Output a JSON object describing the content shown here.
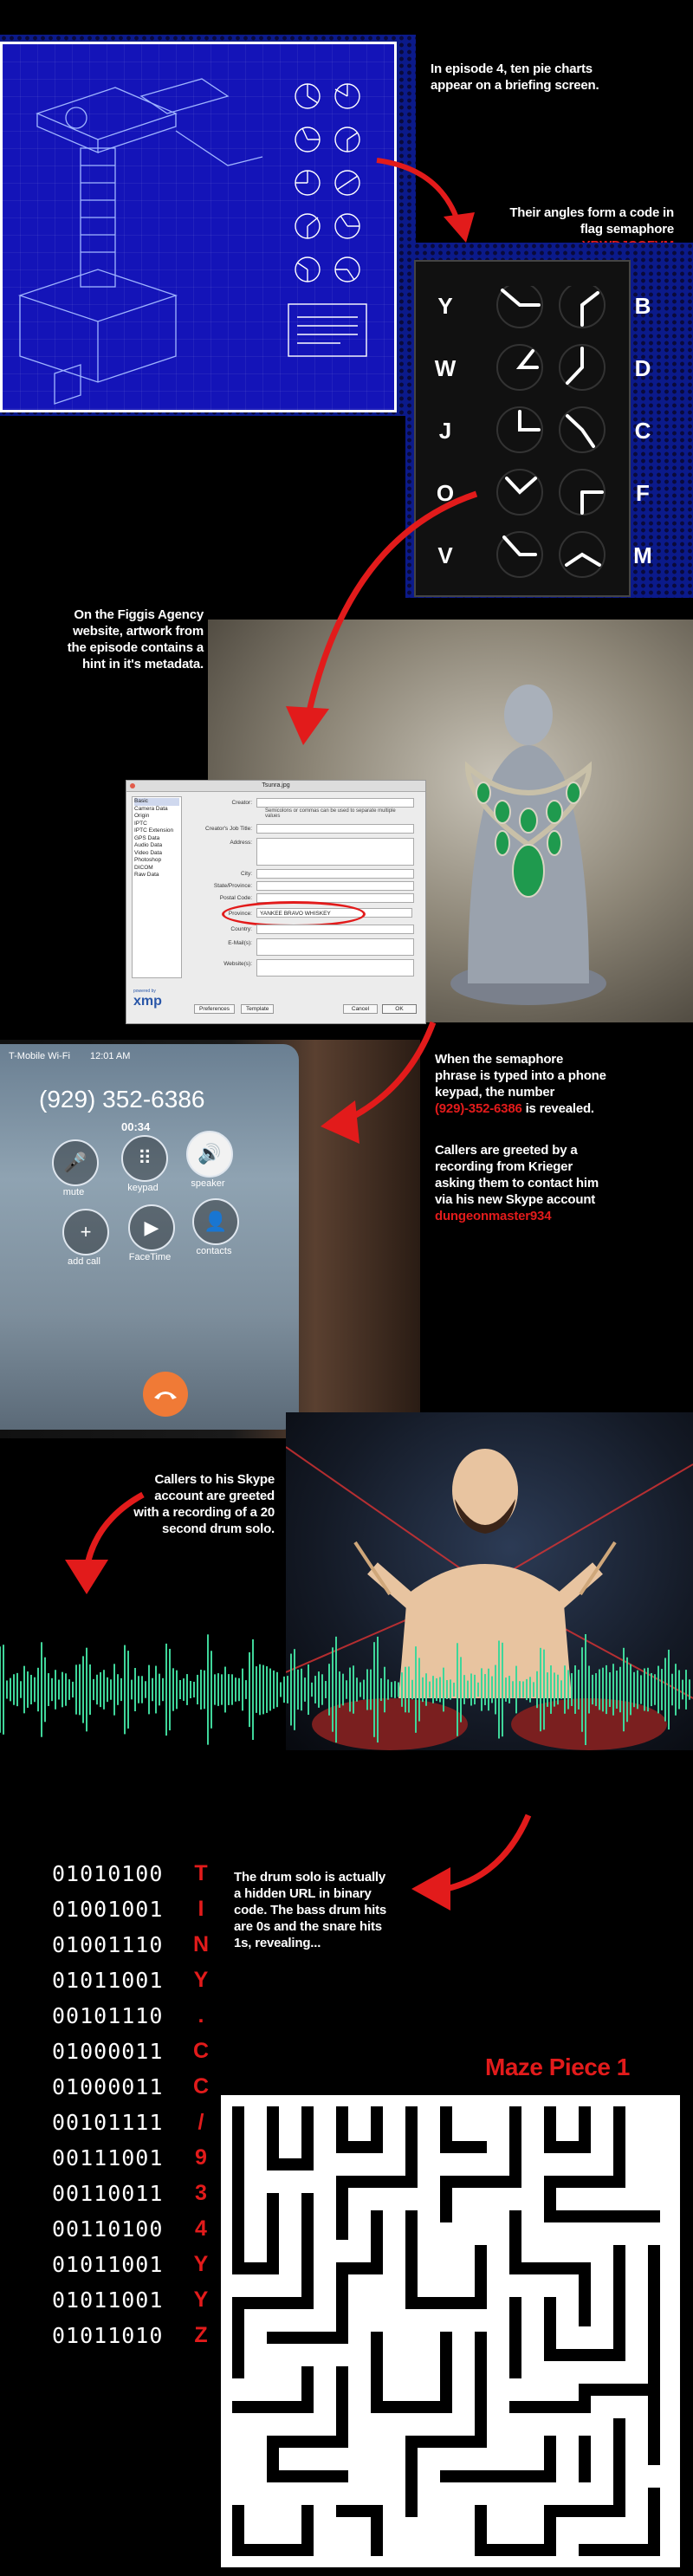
{
  "colors": {
    "accent_red": "#e21b1b",
    "blueprint_blue": "#1414b8",
    "waveform_green": "#3fd69a"
  },
  "captions": {
    "episode": "In episode 4, ten pie charts appear on a briefing screen.",
    "semaphore_prefix": "Their angles form a code in flag semaphore",
    "semaphore_code": "YBWDJCOFVM",
    "figgis": "On the Figgis Agency website, artwork from the episode contains a hint in it's metadata.",
    "phone_prefix": "When the semaphore phrase is typed into a phone keypad, the number",
    "phone_number_red": "(929)-352-6386",
    "phone_suffix": "is revealed.",
    "krieger": "Callers are greeted by a recording from Krieger asking them to contact him via his new Skype account",
    "skype_account": "dungeonmaster934",
    "skype": "Callers to his Skype account are greeted with a recording of a 20 second drum solo.",
    "binary_note": "The drum solo is actually a hidden URL in binary code. The bass drum hits are 0s and the snare hits 1s, revealing...",
    "maze_title": "Maze Piece 1"
  },
  "semaphore": {
    "left_letters": [
      "Y",
      "W",
      "J",
      "O",
      "V"
    ],
    "right_letters": [
      "B",
      "D",
      "C",
      "F",
      "M"
    ]
  },
  "xmp_dialog": {
    "title": "Tsunra.jpg",
    "sidebar": [
      "Basic",
      "Camera Data",
      "Origin",
      "IPTC",
      "IPTC Extension",
      "GPS Data",
      "Audio Data",
      "Video Data",
      "Photoshop",
      "DICOM",
      "Raw Data"
    ],
    "fields": [
      "Creator:",
      "Creator's Job Title:",
      "Address:",
      "City:",
      "State/Province:",
      "Postal Code:",
      "Country:",
      "E-Mail(s):",
      "Website(s):"
    ],
    "creator_hint": "Semicolons or commas can be used to separate multiple values",
    "highlight_label": "Province:",
    "highlight_value": "YANKEE BRAVO WHISKEY",
    "logo_small": "powered by",
    "logo": "xmp",
    "preferences": "Preferences",
    "template": "Template",
    "cancel": "Cancel",
    "ok": "OK"
  },
  "phone": {
    "carrier": "T-Mobile Wi-Fi",
    "time": "12:01 AM",
    "number": "(929) 352-6386",
    "duration": "00:34",
    "buttons": [
      {
        "label": "mute",
        "icon": "🎤"
      },
      {
        "label": "keypad",
        "icon": "⠿"
      },
      {
        "label": "speaker",
        "icon": "🔊"
      },
      {
        "label": "add call",
        "icon": "+"
      },
      {
        "label": "FaceTime",
        "icon": "▶"
      },
      {
        "label": "contacts",
        "icon": "👤"
      }
    ]
  },
  "binary": {
    "bytes": [
      "01010100",
      "01001001",
      "01001110",
      "01011001",
      "00101110",
      "01000011",
      "01000011",
      "00101111",
      "00111001",
      "00110011",
      "00110100",
      "01011001",
      "01011001",
      "01011010"
    ],
    "decoded": [
      "T",
      "I",
      "N",
      "Y",
      ".",
      "C",
      "C",
      "/",
      "9",
      "3",
      "4",
      "Y",
      "Y",
      "Z"
    ]
  }
}
